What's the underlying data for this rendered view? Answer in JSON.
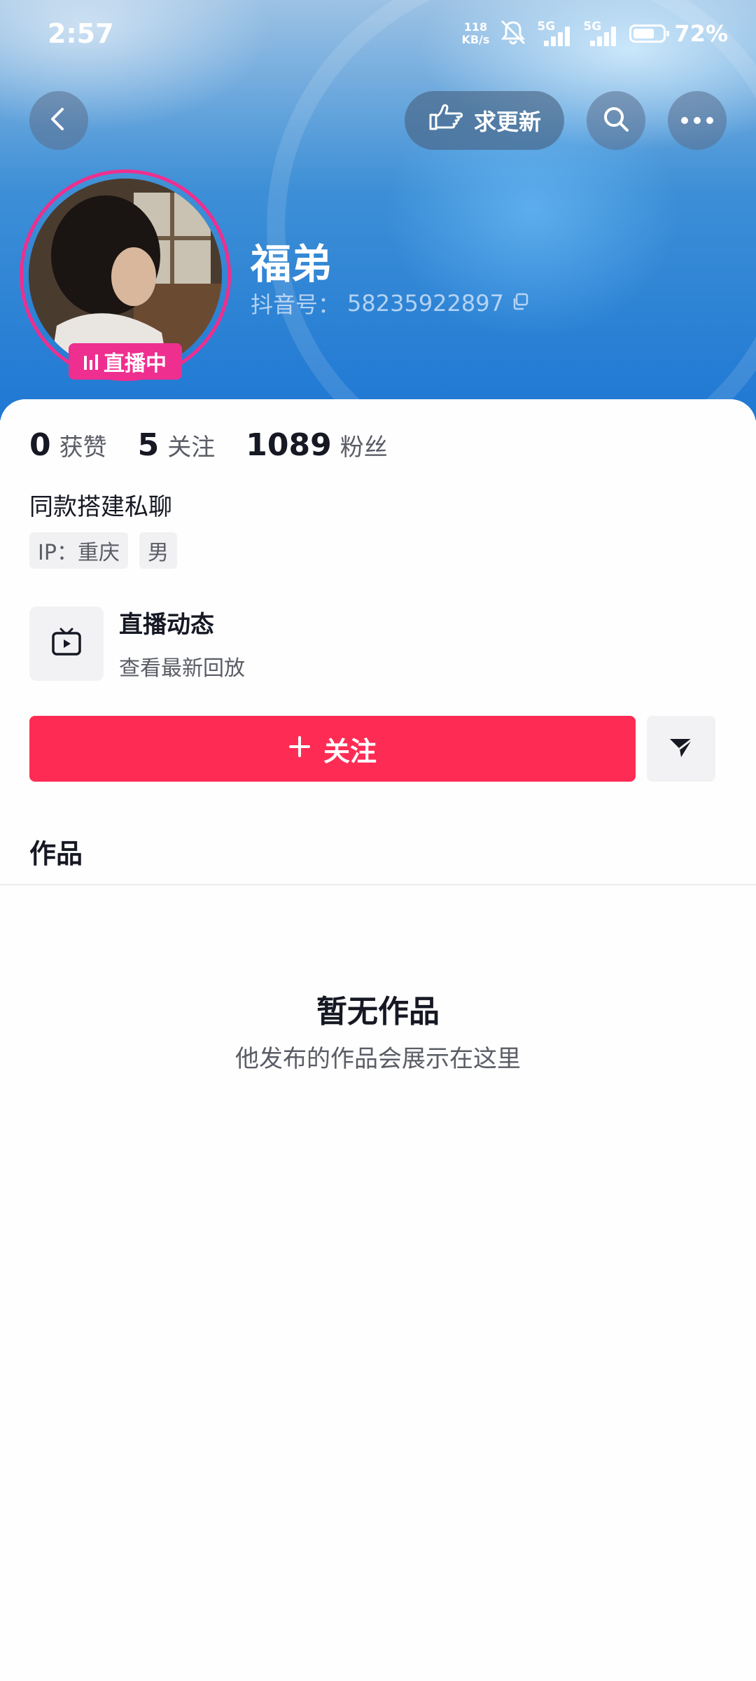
{
  "status_bar": {
    "time": "2:57",
    "net_speed_value": "118",
    "net_speed_unit": "KB/s",
    "signal_1": "5G",
    "signal_2": "5G",
    "battery_percent": 72,
    "battery_text": "72%"
  },
  "nav": {
    "back_icon": "chevron-left-icon",
    "request_update_label": "求更新",
    "request_update_icon": "pointing-hand-icon",
    "search_icon": "search-icon",
    "more_icon": "more-horizontal-icon"
  },
  "profile": {
    "name": "福弟",
    "douyin_id_label": "抖音号：",
    "douyin_id": "58235922897",
    "live_badge": "直播中"
  },
  "stats": [
    {
      "value": "0",
      "label": "获赞"
    },
    {
      "value": "5",
      "label": "关注"
    },
    {
      "value": "1089",
      "label": "粉丝"
    }
  ],
  "bio": "同款搭建私聊",
  "tags": [
    "IP：重庆",
    "男"
  ],
  "live_entry": {
    "title": "直播动态",
    "subtitle": "查看最新回放"
  },
  "actions": {
    "follow_label": "关注",
    "message_icon": "send-icon"
  },
  "works": {
    "tab_label": "作品",
    "empty_title": "暂无作品",
    "empty_subtitle": "他发布的作品会展示在这里"
  },
  "colors": {
    "accent": "#fe2c55",
    "live_pink": "#ee2f8f",
    "header_blue": "#1f78d3"
  }
}
